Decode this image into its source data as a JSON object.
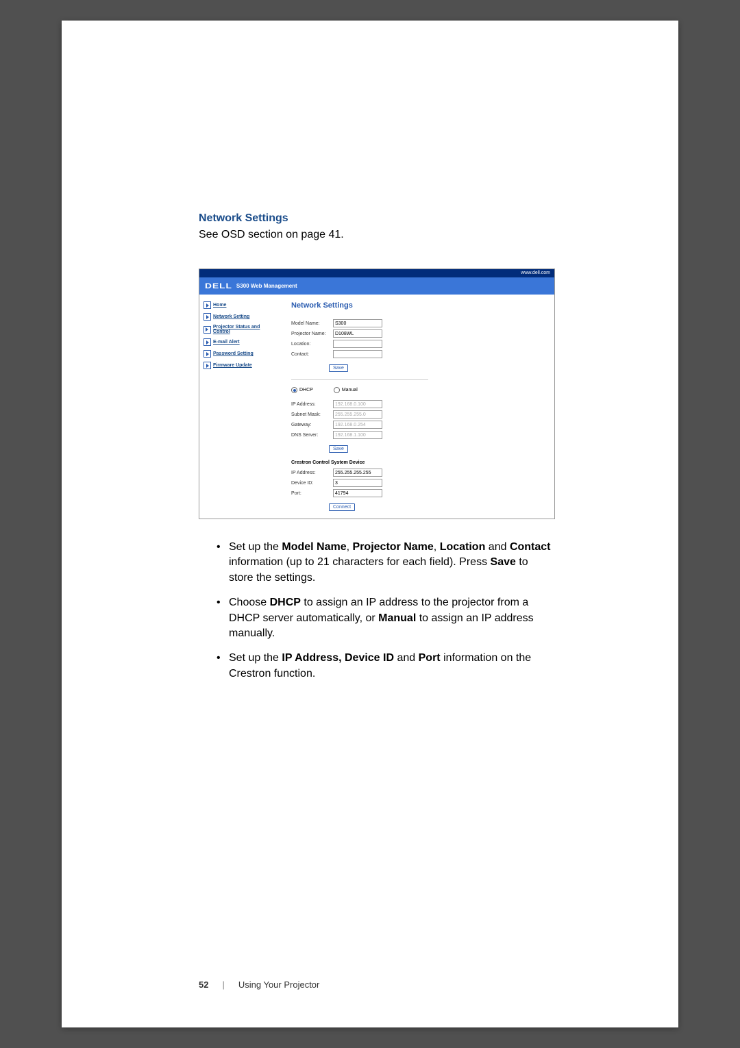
{
  "heading": "Network Settings",
  "intro": "See OSD section on page 41.",
  "topbar": {
    "url": "www.dell.com"
  },
  "titlebar": {
    "logo": "DELL",
    "title": "S300 Web Management"
  },
  "sidebar": {
    "items": [
      {
        "label": "Home"
      },
      {
        "label": "Network Setting"
      },
      {
        "label": "Projector Status and Control"
      },
      {
        "label": "E-mail Alert"
      },
      {
        "label": "Password Setting"
      },
      {
        "label": "Firmware Update"
      }
    ]
  },
  "panel": {
    "heading": "Network Settings",
    "model_name_label": "Model Name:",
    "model_name_value": "S300",
    "projector_name_label": "Projector Name:",
    "projector_name_value": "D108WL",
    "location_label": "Location:",
    "location_value": "",
    "contact_label": "Contact:",
    "contact_value": "",
    "save1": "Save",
    "dhcp_label": "DHCP",
    "manual_label": "Manual",
    "ip_address_label": "IP Address:",
    "ip_address_value": "192.168.0.100",
    "subnet_label": "Subnet Mask:",
    "subnet_value": "255.255.255.0",
    "gateway_label": "Gateway:",
    "gateway_value": "192.168.0.254",
    "dns_label": "DNS Server:",
    "dns_value": "192.168.1.100",
    "save2": "Save",
    "crestron_heading": "Crestron Control System Device",
    "c_ip_label": "IP Address:",
    "c_ip_value": "255.255.255.255",
    "c_device_label": "Device ID:",
    "c_device_value": "3",
    "c_port_label": "Port:",
    "c_port_value": "41794",
    "connect": "Connect"
  },
  "bullets": {
    "b1a": "Set up the ",
    "b1b": "Model Name",
    "b1c": ", ",
    "b1d": "Projector Name",
    "b1e": ", ",
    "b1f": "Location",
    "b1g": " and ",
    "b1h": "Contact",
    "b1i": " information (up to 21 characters for each field). Press ",
    "b1j": "Save",
    "b1k": " to store the settings.",
    "b2a": "Choose ",
    "b2b": "DHCP",
    "b2c": " to assign an IP address to the projector from a DHCP server automatically, or ",
    "b2d": "Manual",
    "b2e": " to assign an IP address manually.",
    "b3a": "Set up the ",
    "b3b": "IP Address, Device ID",
    "b3c": " and ",
    "b3d": "Port",
    "b3e": " information on the Crestron function."
  },
  "footer": {
    "page": "52",
    "section": "Using Your Projector"
  }
}
